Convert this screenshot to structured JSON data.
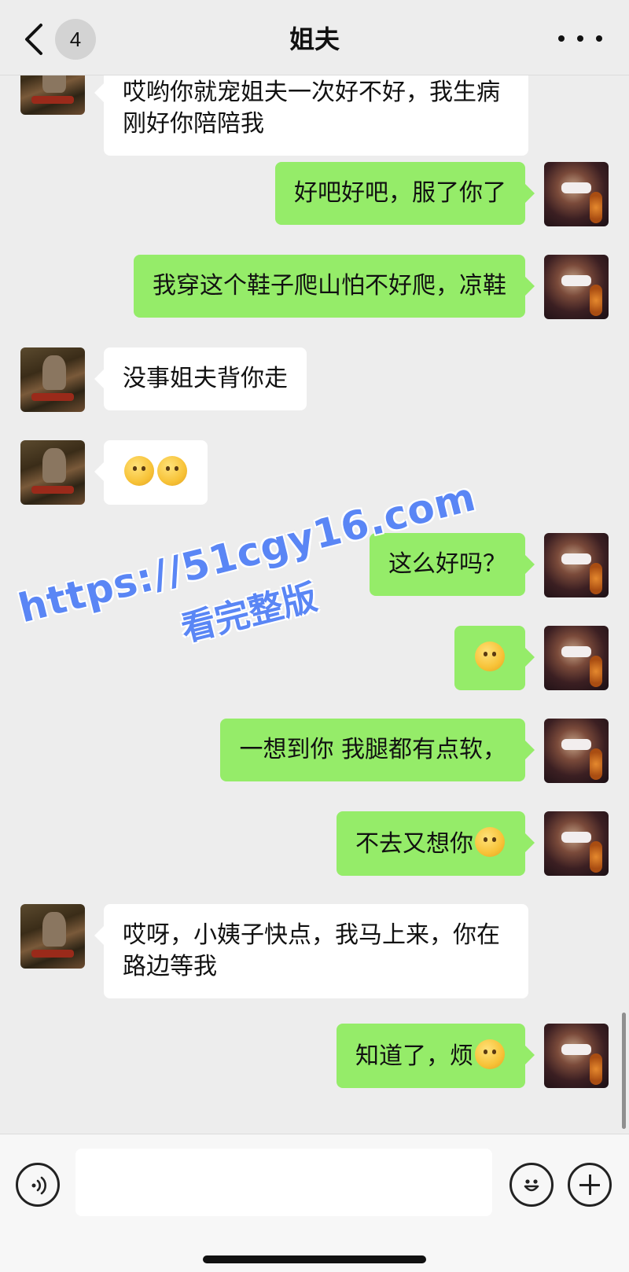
{
  "header": {
    "back_badge": "4",
    "title": "姐夫"
  },
  "messages": [
    {
      "side": "left",
      "lines": "哎哟你就宠姐夫一次好不好，我生病刚好你陪陪我"
    },
    {
      "side": "right",
      "text": "好吧好吧，服了你了"
    },
    {
      "side": "right",
      "text": "我穿这个鞋子爬山怕不好爬，凉鞋"
    },
    {
      "side": "left",
      "text": "没事姐夫背你走"
    },
    {
      "side": "left",
      "emoji": [
        "smirk-emoji",
        "smirk-emoji"
      ]
    },
    {
      "side": "right",
      "text": "这么好吗？"
    },
    {
      "side": "right",
      "emoji": [
        "flushed-emoji"
      ]
    },
    {
      "side": "right",
      "text": "一想到你 我腿都有点软，"
    },
    {
      "side": "right",
      "text": "不去又想你",
      "trailing_emoji": "laughing-tears-emoji"
    },
    {
      "side": "left",
      "lines": "哎呀，小姨子快点，我马上来，你在路边等我"
    },
    {
      "side": "right",
      "text": "知道了，烦",
      "trailing_emoji": "tongue-emoji"
    }
  ],
  "watermark": {
    "line1": "https://51cgy16.com",
    "line2": "看完整版"
  },
  "input": {
    "value": ""
  },
  "colors": {
    "background": "#ededed",
    "sent_bubble": "#95ec69",
    "received_bubble": "#ffffff",
    "watermark": "#5a86f5"
  }
}
